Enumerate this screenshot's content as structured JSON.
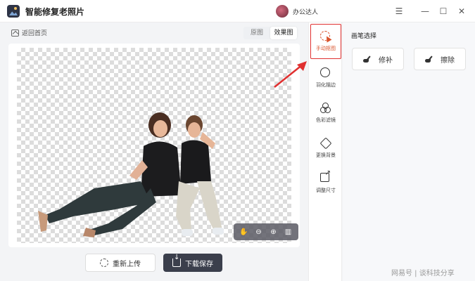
{
  "app": {
    "title": "智能修复老照片",
    "username": "办公达人"
  },
  "window_controls": {
    "menu": "☰",
    "minimize": "—",
    "maximize": "☐",
    "close": "✕"
  },
  "nav": {
    "back_label": "返回首页"
  },
  "view_toggle": {
    "original": "原图",
    "result": "效果图",
    "selected": "效果图"
  },
  "canvas": {
    "zoom_tools": [
      "hand-icon",
      "zoom-out-icon",
      "zoom-in-icon",
      "compare-icon"
    ]
  },
  "actions": {
    "reupload": "重新上传",
    "download": "下载保存"
  },
  "tools": [
    {
      "label": "手动抠图",
      "icon": "manual-cutout-icon",
      "active": true
    },
    {
      "label": "羽化描边",
      "icon": "feather-edge-icon",
      "active": false
    },
    {
      "label": "色彩滤镜",
      "icon": "color-filter-icon",
      "active": false
    },
    {
      "label": "更换背景",
      "icon": "change-background-icon",
      "active": false
    },
    {
      "label": "调整尺寸",
      "icon": "resize-icon",
      "active": false
    }
  ],
  "brush_panel": {
    "title": "画笔选择",
    "repair": "修补",
    "erase": "擦除"
  },
  "watermark": "网易号 | 谈科技分享",
  "colors": {
    "accent": "#d9532c",
    "highlight_border": "#e03030",
    "dark_button": "#3b3f4c"
  }
}
